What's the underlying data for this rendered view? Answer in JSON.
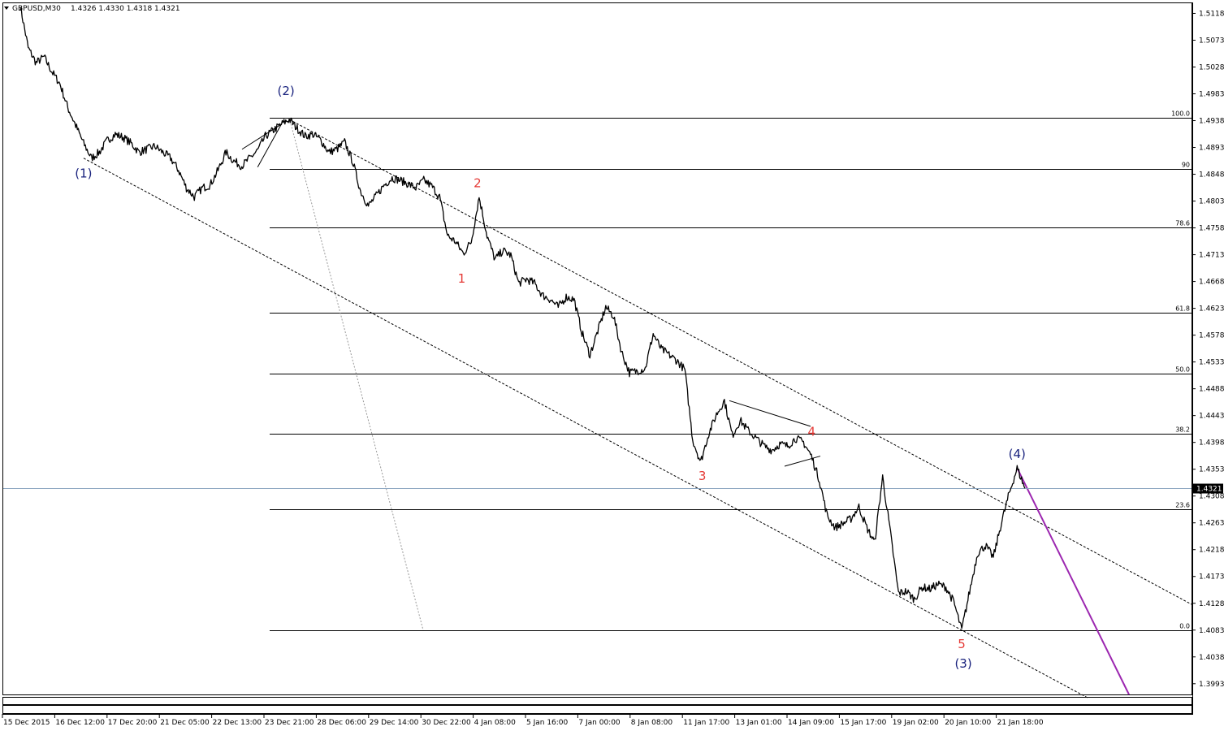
{
  "header": {
    "symbol": "GBPUSD,M30",
    "ohlc": "1.4326 1.4330 1.4318 1.4321"
  },
  "chart_data": {
    "type": "line",
    "instrument": "GBPUSD",
    "timeframe": "M30",
    "ylim": [
      1.3975,
      1.5135
    ],
    "y_ticks": [
      "1.5118",
      "1.5073",
      "1.5028",
      "1.4983",
      "1.4938",
      "1.4893",
      "1.4848",
      "1.4803",
      "1.4758",
      "1.4713",
      "1.4668",
      "1.4623",
      "1.4578",
      "1.4533",
      "1.4488",
      "1.4443",
      "1.4398",
      "1.4353",
      "1.4308",
      "1.4263",
      "1.4218",
      "1.4173",
      "1.4128",
      "1.4083",
      "1.4038",
      "1.3993"
    ],
    "x_ticks": [
      "15 Dec 2015",
      "16 Dec 12:00",
      "17 Dec 20:00",
      "21 Dec 05:00",
      "22 Dec 13:00",
      "23 Dec 21:00",
      "28 Dec 06:00",
      "29 Dec 14:00",
      "30 Dec 22:00",
      "4 Jan 08:00",
      "5 Jan 16:00",
      "7 Jan 00:00",
      "8 Jan 08:00",
      "11 Jan 17:00",
      "13 Jan 01:00",
      "14 Jan 09:00",
      "15 Jan 17:00",
      "19 Jan 02:00",
      "20 Jan 10:00",
      "21 Jan 18:00"
    ],
    "current_price": "1.4321",
    "price_path": [
      [
        0,
        1.513
      ],
      [
        1,
        1.506
      ],
      [
        2,
        1.5035
      ],
      [
        3,
        1.5045
      ],
      [
        4,
        1.502
      ],
      [
        5,
        1.5
      ],
      [
        6,
        1.496
      ],
      [
        7,
        1.493
      ],
      [
        8,
        1.49
      ],
      [
        9,
        1.4875
      ],
      [
        10,
        1.4885
      ],
      [
        11,
        1.4905
      ],
      [
        12,
        1.4915
      ],
      [
        13,
        1.491
      ],
      [
        14,
        1.49
      ],
      [
        15,
        1.4885
      ],
      [
        16,
        1.489
      ],
      [
        17,
        1.4895
      ],
      [
        18,
        1.4885
      ],
      [
        19,
        1.4875
      ],
      [
        20,
        1.4855
      ],
      [
        21,
        1.4825
      ],
      [
        22,
        1.481
      ],
      [
        23,
        1.4825
      ],
      [
        24,
        1.483
      ],
      [
        25,
        1.4855
      ],
      [
        26,
        1.4885
      ],
      [
        27,
        1.487
      ],
      [
        28,
        1.4862
      ],
      [
        29,
        1.4875
      ],
      [
        30,
        1.4888
      ],
      [
        31,
        1.4912
      ],
      [
        32,
        1.4922
      ],
      [
        33,
        1.4932
      ],
      [
        34,
        1.494
      ],
      [
        35,
        1.4925
      ],
      [
        36,
        1.4912
      ],
      [
        37,
        1.4915
      ],
      [
        38,
        1.4905
      ],
      [
        39,
        1.4885
      ],
      [
        40,
        1.489
      ],
      [
        41,
        1.4902
      ],
      [
        42,
        1.487
      ],
      [
        43,
        1.482
      ],
      [
        44,
        1.4795
      ],
      [
        45,
        1.4812
      ],
      [
        46,
        1.483
      ],
      [
        47,
        1.4842
      ],
      [
        48,
        1.4838
      ],
      [
        49,
        1.4832
      ],
      [
        50,
        1.4825
      ],
      [
        51,
        1.4838
      ],
      [
        52,
        1.4828
      ],
      [
        53,
        1.481
      ],
      [
        54,
        1.4745
      ],
      [
        55,
        1.4735
      ],
      [
        56,
        1.4715
      ],
      [
        57,
        1.4735
      ],
      [
        58,
        1.481
      ],
      [
        59,
        1.4745
      ],
      [
        60,
        1.4705
      ],
      [
        61,
        1.472
      ],
      [
        62,
        1.4712
      ],
      [
        63,
        1.4665
      ],
      [
        64,
        1.4672
      ],
      [
        65,
        1.4665
      ],
      [
        66,
        1.4645
      ],
      [
        67,
        1.4638
      ],
      [
        68,
        1.4625
      ],
      [
        69,
        1.4642
      ],
      [
        70,
        1.4638
      ],
      [
        71,
        1.4582
      ],
      [
        72,
        1.4545
      ],
      [
        73,
        1.4585
      ],
      [
        74,
        1.4625
      ],
      [
        75,
        1.461
      ],
      [
        76,
        1.455
      ],
      [
        77,
        1.4515
      ],
      [
        78,
        1.4518
      ],
      [
        79,
        1.4522
      ],
      [
        80,
        1.458
      ],
      [
        81,
        1.4555
      ],
      [
        82,
        1.4545
      ],
      [
        83,
        1.4535
      ],
      [
        84,
        1.452
      ],
      [
        85,
        1.4402
      ],
      [
        86,
        1.4365
      ],
      [
        87,
        1.4412
      ],
      [
        88,
        1.4445
      ],
      [
        89,
        1.4468
      ],
      [
        90,
        1.441
      ],
      [
        91,
        1.4435
      ],
      [
        92,
        1.4418
      ],
      [
        93,
        1.4405
      ],
      [
        94,
        1.4392
      ],
      [
        95,
        1.4385
      ],
      [
        96,
        1.4395
      ],
      [
        97,
        1.4392
      ],
      [
        98,
        1.4405
      ],
      [
        99,
        1.4398
      ],
      [
        100,
        1.4375
      ],
      [
        101,
        1.4335
      ],
      [
        102,
        1.4275
      ],
      [
        103,
        1.4255
      ],
      [
        104,
        1.4262
      ],
      [
        105,
        1.427
      ],
      [
        106,
        1.429
      ],
      [
        107,
        1.4255
      ],
      [
        108,
        1.423
      ],
      [
        109,
        1.434
      ],
      [
        110,
        1.4245
      ],
      [
        111,
        1.4145
      ],
      [
        112,
        1.4148
      ],
      [
        113,
        1.4135
      ],
      [
        114,
        1.4155
      ],
      [
        115,
        1.4152
      ],
      [
        116,
        1.416
      ],
      [
        117,
        1.4155
      ],
      [
        118,
        1.413
      ],
      [
        119,
        1.4083
      ],
      [
        120,
        1.4148
      ],
      [
        121,
        1.4212
      ],
      [
        122,
        1.4225
      ],
      [
        123,
        1.4205
      ],
      [
        124,
        1.4262
      ],
      [
        125,
        1.4312
      ],
      [
        126,
        1.4355
      ],
      [
        127,
        1.4321
      ]
    ],
    "fibonacci": [
      {
        "label": "100.0",
        "price": 1.4943
      },
      {
        "label": "90",
        "price": 1.4857
      },
      {
        "label": "78.6",
        "price": 1.4759
      },
      {
        "label": "61.8",
        "price": 1.4615
      },
      {
        "label": "50.0",
        "price": 1.4513
      },
      {
        "label": "38.2",
        "price": 1.4412
      },
      {
        "label": "23.6",
        "price": 1.4286
      },
      {
        "label": "0.0",
        "price": 1.4083
      }
    ],
    "wave_labels": [
      {
        "text": "(1)",
        "color": "#1a237e"
      },
      {
        "text": "(2)",
        "color": "#1a237e"
      },
      {
        "text": "1",
        "color": "#e53935"
      },
      {
        "text": "2",
        "color": "#e53935"
      },
      {
        "text": "3",
        "color": "#e53935"
      },
      {
        "text": "4",
        "color": "#e53935"
      },
      {
        "text": "5",
        "color": "#e53935"
      },
      {
        "text": "(3)",
        "color": "#1a237e"
      },
      {
        "text": "(4)",
        "color": "#1a237e"
      }
    ],
    "grid": false,
    "colors": {
      "price": "#000000",
      "projection": "#9c27b0",
      "current_line": "#8aa4bf",
      "tag_bg": "#000000",
      "tag_text": "#ffffff"
    }
  }
}
